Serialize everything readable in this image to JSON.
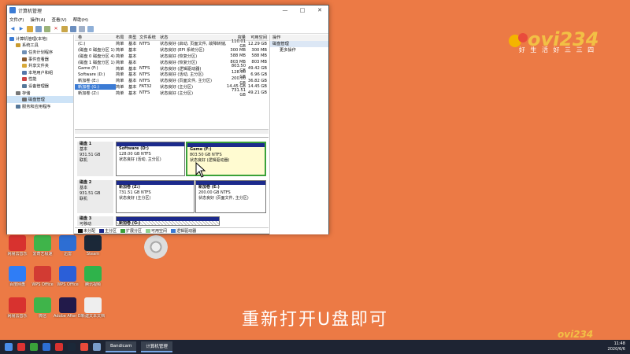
{
  "window": {
    "title": "计算机管理",
    "min": "—",
    "max": "□",
    "close": "✕"
  },
  "menu": [
    "文件(F)",
    "操作(A)",
    "查看(V)",
    "帮助(H)"
  ],
  "tree": [
    {
      "label": "计算机管理(本地)",
      "indent": 0,
      "color": "#3b7bd4"
    },
    {
      "label": "系统工具",
      "indent": 1,
      "color": "#c99a2e"
    },
    {
      "label": "任务计划程序",
      "indent": 2,
      "color": "#6f8fb5"
    },
    {
      "label": "事件查看器",
      "indent": 2,
      "color": "#8a5a2e"
    },
    {
      "label": "共享文件夹",
      "indent": 2,
      "color": "#d8a93a"
    },
    {
      "label": "本地用户和组",
      "indent": 2,
      "color": "#5577aa"
    },
    {
      "label": "性能",
      "indent": 2,
      "color": "#cc4444"
    },
    {
      "label": "设备管理器",
      "indent": 2,
      "color": "#557799"
    },
    {
      "label": "存储",
      "indent": 1,
      "color": "#777777"
    },
    {
      "label": "磁盘管理",
      "indent": 2,
      "color": "#6b6b6b",
      "selected": true
    },
    {
      "label": "服务和应用程序",
      "indent": 1,
      "color": "#557799"
    }
  ],
  "volume_table": {
    "headers": [
      "卷",
      "布局",
      "类型",
      "文件系统",
      "状态",
      "容量",
      "可用空间"
    ],
    "rows": [
      [
        "(C:)",
        "简单",
        "基本",
        "NTFS",
        "状态良好 (启动, 页面文件, 故障转储, 基本数据分区)",
        "110.01 GB",
        "12.29 GB"
      ],
      [
        "(磁盘 0 磁盘分区 1)",
        "简单",
        "基本",
        "",
        "状态良好 (EFI 系统分区)",
        "300 MB",
        "300 MB"
      ],
      [
        "(磁盘 0 磁盘分区 4)",
        "简单",
        "基本",
        "",
        "状态良好 (恢复分区)",
        "588 MB",
        "588 MB"
      ],
      [
        "(磁盘 1 磁盘分区 1)",
        "简单",
        "基本",
        "",
        "状态良好 (恢复分区)",
        "803 MB",
        "803 MB"
      ],
      [
        "Game (F:)",
        "简单",
        "基本",
        "NTFS",
        "状态良好 (逻辑驱动器)",
        "803.50 GB",
        "49.42 GB"
      ],
      [
        "Software (D:)",
        "简单",
        "基本",
        "NTFS",
        "状态良好 (活动, 主分区)",
        "128.00 GB",
        "6.96 GB"
      ],
      [
        "新加卷 (E:)",
        "简单",
        "基本",
        "NTFS",
        "状态良好 (页面文件, 主分区)",
        "200.00 GB",
        "36.82 GB"
      ],
      [
        "新加卷 (G:)",
        "简单",
        "基本",
        "FAT32",
        "状态良好 (主分区)",
        "14.45 GB",
        "14.45 GB"
      ],
      [
        "新加卷 (Z:)",
        "简单",
        "基本",
        "NTFS",
        "状态良好 (主分区)",
        "731.51 GB",
        "49.21 GB"
      ]
    ]
  },
  "disks": [
    {
      "name": "磁盘 1",
      "type": "基本",
      "size": "931.51 GB",
      "status": "联机"
    },
    {
      "name": "磁盘 2",
      "type": "基本",
      "size": "931.51 GB",
      "status": "联机"
    },
    {
      "name": "磁盘 3",
      "type": "可移动",
      "size": "",
      "status": ""
    }
  ],
  "partitions": {
    "d1a": {
      "name": "Software (D:)",
      "size": "128.00 GB NTFS",
      "status": "状态良好 (活动, 主分区)"
    },
    "d1b": {
      "name": "Game (F:)",
      "size": "803.50 GB NTFS",
      "status": "状态良好 (逻辑驱动器)"
    },
    "d2a": {
      "name": "新加卷 (Z:)",
      "size": "731.51 GB NTFS",
      "status": "状态良好 (主分区)"
    },
    "d2b": {
      "name": "新加卷 (E:)",
      "size": "200.00 GB NTFS",
      "status": "状态良好 (页面文件, 主分区)"
    },
    "d3a": {
      "name": "新加卷 (G:)"
    }
  },
  "legend": [
    "未分配",
    "主分区",
    "扩展分区",
    "可用空间",
    "逻辑驱动器"
  ],
  "actions": {
    "header": "操作",
    "section": "磁盘管理",
    "more": "更多操作"
  },
  "desktop_icons": [
    {
      "label": "网易云音乐",
      "color": "#d8322f"
    },
    {
      "label": "爱奇艺极速",
      "color": "#3fb44a"
    },
    {
      "label": "迅雷",
      "color": "#2d6ed3"
    },
    {
      "label": "Steam",
      "color": "#1b2838"
    },
    {
      "label": "百度网盘",
      "color": "#2f7df6"
    },
    {
      "label": "WPS Office",
      "color": "#d23b33"
    },
    {
      "label": "WPS Office",
      "color": "#2b5fd8"
    },
    {
      "label": "腾讯视频",
      "color": "#2fb34b"
    },
    {
      "label": "网易云音乐",
      "color": "#d8322f"
    },
    {
      "label": "微信",
      "color": "#3fb44a"
    },
    {
      "label": "Adobe After Effects 2020",
      "color": "#221a4a"
    },
    {
      "label": "新建文本文档",
      "color": "#eeeeee"
    }
  ],
  "caption": "重新打开U盘即可",
  "logo": {
    "text": "好 生 活 好 三 三 四",
    "mark": "ovi234"
  },
  "taskbar": {
    "app1": "Bandicam",
    "app2": "计算机管理",
    "time": "11:48",
    "date": "2020/6/6"
  }
}
